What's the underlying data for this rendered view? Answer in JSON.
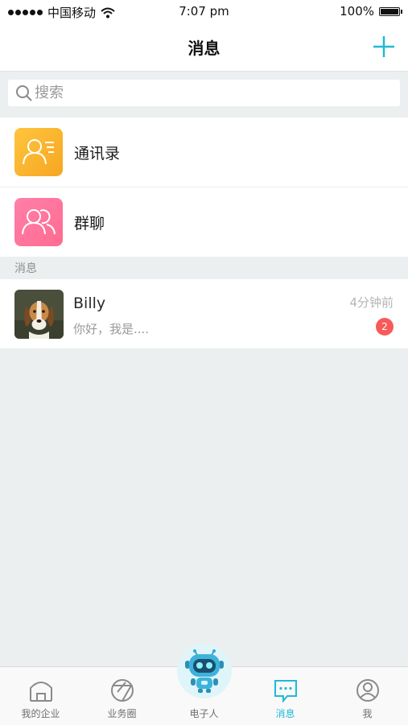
{
  "status_bar": {
    "carrier": "中国移动",
    "time": "7:07 pm",
    "battery": "100%",
    "battery_level": 1.0
  },
  "nav": {
    "title": "消息",
    "add_icon": "plus-icon"
  },
  "search": {
    "placeholder": "搜索",
    "icon": "search-icon"
  },
  "entries": [
    {
      "label": "通讯录",
      "icon": "contacts-icon",
      "color": "#f9b12e"
    },
    {
      "label": "群聊",
      "icon": "group-icon",
      "color": "#ff7299"
    }
  ],
  "section": {
    "label": "消息"
  },
  "messages": [
    {
      "name": "Billy",
      "preview": "你好，我是....",
      "time": "4分钟前",
      "unread": "2",
      "avatar": "dog-avatar"
    }
  ],
  "tabs": [
    {
      "label": "我的企业",
      "icon": "building-icon"
    },
    {
      "label": "业务圈",
      "icon": "circle-triangle-icon"
    },
    {
      "label": "电子人",
      "icon": "robot-icon"
    },
    {
      "label": "消息",
      "icon": "chat-icon",
      "active": true
    },
    {
      "label": "我",
      "icon": "user-icon"
    }
  ],
  "colors": {
    "accent": "#21b9d6",
    "badge": "#f85a5a",
    "background": "#eceff0"
  }
}
